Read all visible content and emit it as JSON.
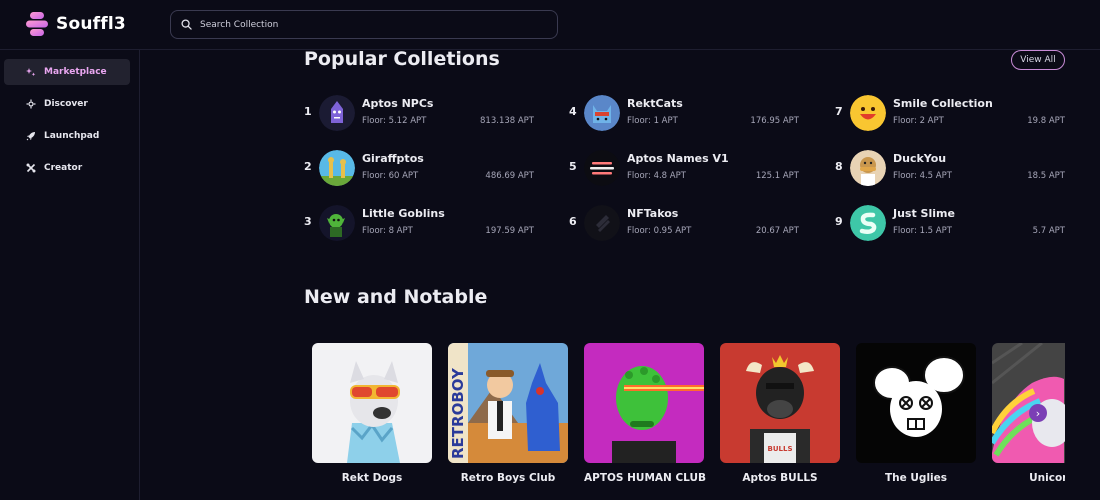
{
  "header": {
    "brand": "Souffl3",
    "search_placeholder": "Search Collection"
  },
  "sidebar": {
    "items": [
      {
        "label": "Marketplace",
        "icon": "sparkle-icon",
        "active": true
      },
      {
        "label": "Discover",
        "icon": "compass-icon",
        "active": false
      },
      {
        "label": "Launchpad",
        "icon": "rocket-icon",
        "active": false
      },
      {
        "label": "Creator",
        "icon": "tools-icon",
        "active": false
      }
    ]
  },
  "popular": {
    "title": "Popular Colletions",
    "view_all": "View All",
    "collections": [
      {
        "rank": "1",
        "name": "Aptos NPCs",
        "floor": "Floor: 5.12 APT",
        "volume": "813.138 APT"
      },
      {
        "rank": "2",
        "name": "Giraffptos",
        "floor": "Floor: 60 APT",
        "volume": "486.69 APT"
      },
      {
        "rank": "3",
        "name": "Little Goblins",
        "floor": "Floor: 8 APT",
        "volume": "197.59 APT"
      },
      {
        "rank": "4",
        "name": "RektCats",
        "floor": "Floor: 1 APT",
        "volume": "176.95 APT"
      },
      {
        "rank": "5",
        "name": "Aptos Names V1",
        "floor": "Floor: 4.8 APT",
        "volume": "125.1 APT"
      },
      {
        "rank": "6",
        "name": "NFTakos",
        "floor": "Floor: 0.95 APT",
        "volume": "20.67 APT"
      },
      {
        "rank": "7",
        "name": "Smile Collection",
        "floor": "Floor: 2 APT",
        "volume": "19.8 APT"
      },
      {
        "rank": "8",
        "name": "DuckYou",
        "floor": "Floor: 4.5 APT",
        "volume": "18.5 APT"
      },
      {
        "rank": "9",
        "name": "Just Slime",
        "floor": "Floor: 1.5 APT",
        "volume": "5.7 APT"
      }
    ]
  },
  "notable": {
    "title": "New and Notable",
    "cards": [
      {
        "label": "Rekt Dogs"
      },
      {
        "label": "Retro Boys Club",
        "art_text": "RETROBOY"
      },
      {
        "label": "APTOS HUMAN CLUB"
      },
      {
        "label": "Aptos BULLS",
        "art_text": "BULLS"
      },
      {
        "label": "The Uglies"
      },
      {
        "label": "Unicorn"
      }
    ],
    "next": "›"
  }
}
